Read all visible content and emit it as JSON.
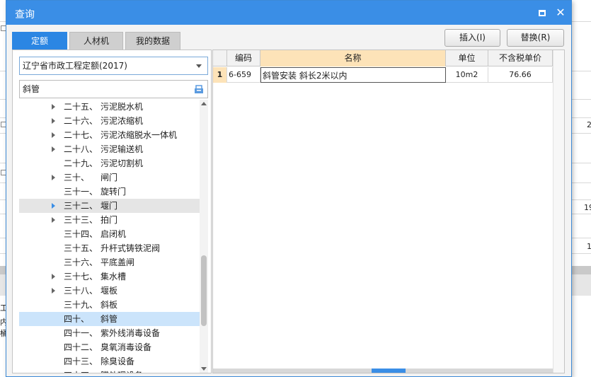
{
  "window": {
    "title": "查询"
  },
  "tabs": [
    {
      "label": "定额"
    },
    {
      "label": "人材机"
    },
    {
      "label": "我的数据"
    }
  ],
  "toolbar": {
    "insert_label": "插入(I)",
    "replace_label": "替换(R)"
  },
  "quota_select": {
    "value": "辽宁省市政工程定额(2017)"
  },
  "search": {
    "value": "斜管"
  },
  "tree": [
    {
      "num": "二十五、",
      "label": "污泥脱水机",
      "expand": true
    },
    {
      "num": "二十六、",
      "label": "污泥浓缩机",
      "expand": true
    },
    {
      "num": "二十七、",
      "label": "污泥浓缩脱水一体机",
      "expand": true
    },
    {
      "num": "二十八、",
      "label": "污泥输送机",
      "expand": true
    },
    {
      "num": "二十九、",
      "label": "污泥切割机",
      "expand": false
    },
    {
      "num": "三十、",
      "label": "闸门",
      "expand": true
    },
    {
      "num": "三十一、",
      "label": "旋转门",
      "expand": false
    },
    {
      "num": "三十二、",
      "label": "堰门",
      "expand": true
    },
    {
      "num": "三十三、",
      "label": "拍门",
      "expand": true
    },
    {
      "num": "三十四、",
      "label": "启闭机",
      "expand": false
    },
    {
      "num": "三十五、",
      "label": "升杆式铸铁泥阀",
      "expand": false
    },
    {
      "num": "三十六、",
      "label": "平底盖闸",
      "expand": false
    },
    {
      "num": "三十七、",
      "label": "集水槽",
      "expand": true
    },
    {
      "num": "三十八、",
      "label": "堰板",
      "expand": true
    },
    {
      "num": "三十九、",
      "label": "斜板",
      "expand": false
    },
    {
      "num": "四十、",
      "label": "斜管",
      "expand": false
    },
    {
      "num": "四十一、",
      "label": "紫外线消毒设备",
      "expand": false
    },
    {
      "num": "四十二、",
      "label": "臭氧消毒设备",
      "expand": false
    },
    {
      "num": "四十三、",
      "label": "除臭设备",
      "expand": false
    },
    {
      "num": "四十四、",
      "label": "膜处理设备",
      "expand": false
    }
  ],
  "grid": {
    "columns": [
      "编码",
      "名称",
      "单位",
      "不含税单价"
    ],
    "rows": [
      {
        "row": "1",
        "code": "6-659",
        "name": "斜管安装 斜长2米以内",
        "unit": "10m2",
        "price": "76.66"
      }
    ]
  },
  "background": {
    "values": [
      "2",
      "19",
      "1"
    ],
    "side_chars": [
      "工",
      "内",
      "桶"
    ]
  },
  "colors": {
    "titlebar": "#3a8ee6",
    "active_tab": "#2b86e3",
    "header_highlight": "#fde3b8",
    "selected_row": "#cbe4fb"
  }
}
